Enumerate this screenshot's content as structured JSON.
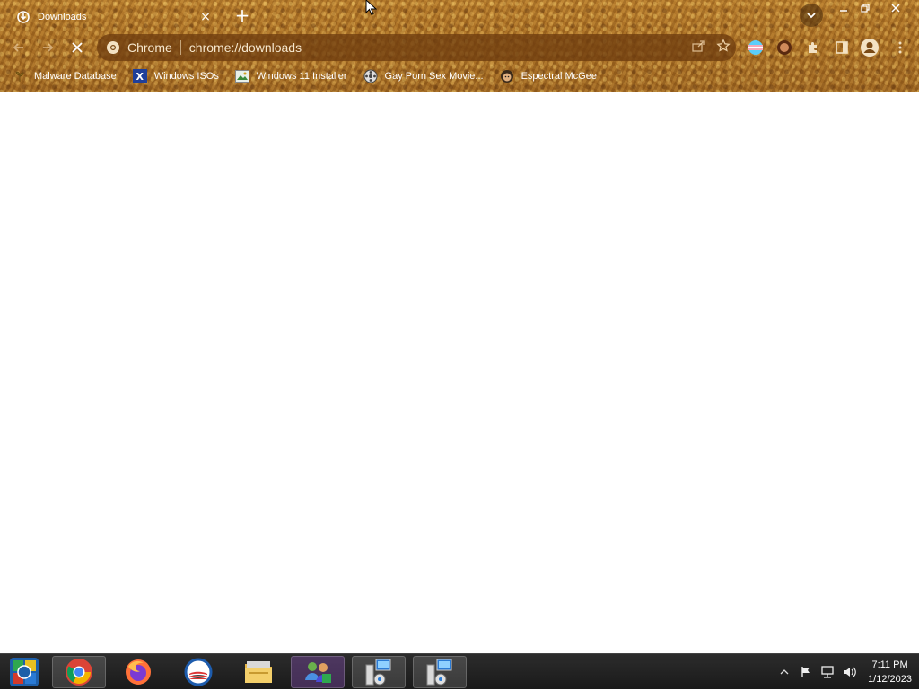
{
  "tab": {
    "title": "Downloads",
    "close": "×",
    "new_tab": "+"
  },
  "toolbar": {
    "site_label": "Chrome",
    "url": "chrome://downloads"
  },
  "bookmarks": [
    {
      "label": "Malware Database",
      "icon": "plant-icon"
    },
    {
      "label": "Windows ISOs",
      "icon": "x-logo-icon"
    },
    {
      "label": "Windows 11 Installer",
      "icon": "image-icon"
    },
    {
      "label": "Gay Porn Sex Movie...",
      "icon": "reel-icon"
    },
    {
      "label": "Espectral McGee",
      "icon": "face-icon"
    }
  ],
  "taskbar": {
    "apps": [
      "start-orb",
      "chrome",
      "firefox",
      "outlook",
      "file-explorer",
      "people-app",
      "network-setup-1",
      "network-setup-2"
    ],
    "clock_time": "7:11 PM",
    "clock_date": "1/12/2023"
  },
  "colors": {
    "theme": "#a86d22",
    "taskbar": "#1f1f1f"
  }
}
